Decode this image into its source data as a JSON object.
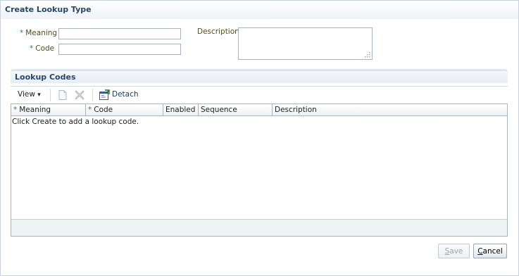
{
  "dialog": {
    "title": "Create Lookup Type"
  },
  "form": {
    "meaning": {
      "required_mark": "*",
      "label": "Meaning",
      "value": ""
    },
    "code": {
      "required_mark": "*",
      "label": "Code",
      "value": ""
    },
    "description": {
      "label": "Description",
      "value": ""
    }
  },
  "lookup_codes": {
    "title": "Lookup Codes",
    "toolbar": {
      "view_label": "View",
      "view_arrow": "▾",
      "create_icon": "new-document-icon",
      "delete_icon": "delete-x-icon",
      "detach_icon": "detach-icon",
      "detach_label": "Detach"
    },
    "columns": [
      {
        "required_mark": "*",
        "label": "Meaning"
      },
      {
        "required_mark": "*",
        "label": "Code"
      },
      {
        "required_mark": "",
        "label": "Enabled"
      },
      {
        "required_mark": "",
        "label": "Sequence"
      },
      {
        "required_mark": "",
        "label": "Description"
      }
    ],
    "empty_message": "Click Create to add a lookup code."
  },
  "buttons": {
    "save": {
      "mnemonic": "S",
      "rest": "ave",
      "enabled": false
    },
    "cancel": {
      "mnemonic": "C",
      "rest": "ancel",
      "enabled": true
    }
  },
  "colors": {
    "title_text": "#27466b",
    "label_text": "#584c1c",
    "required_mark": "#3a6fa4",
    "border": "#a8b6c4"
  }
}
